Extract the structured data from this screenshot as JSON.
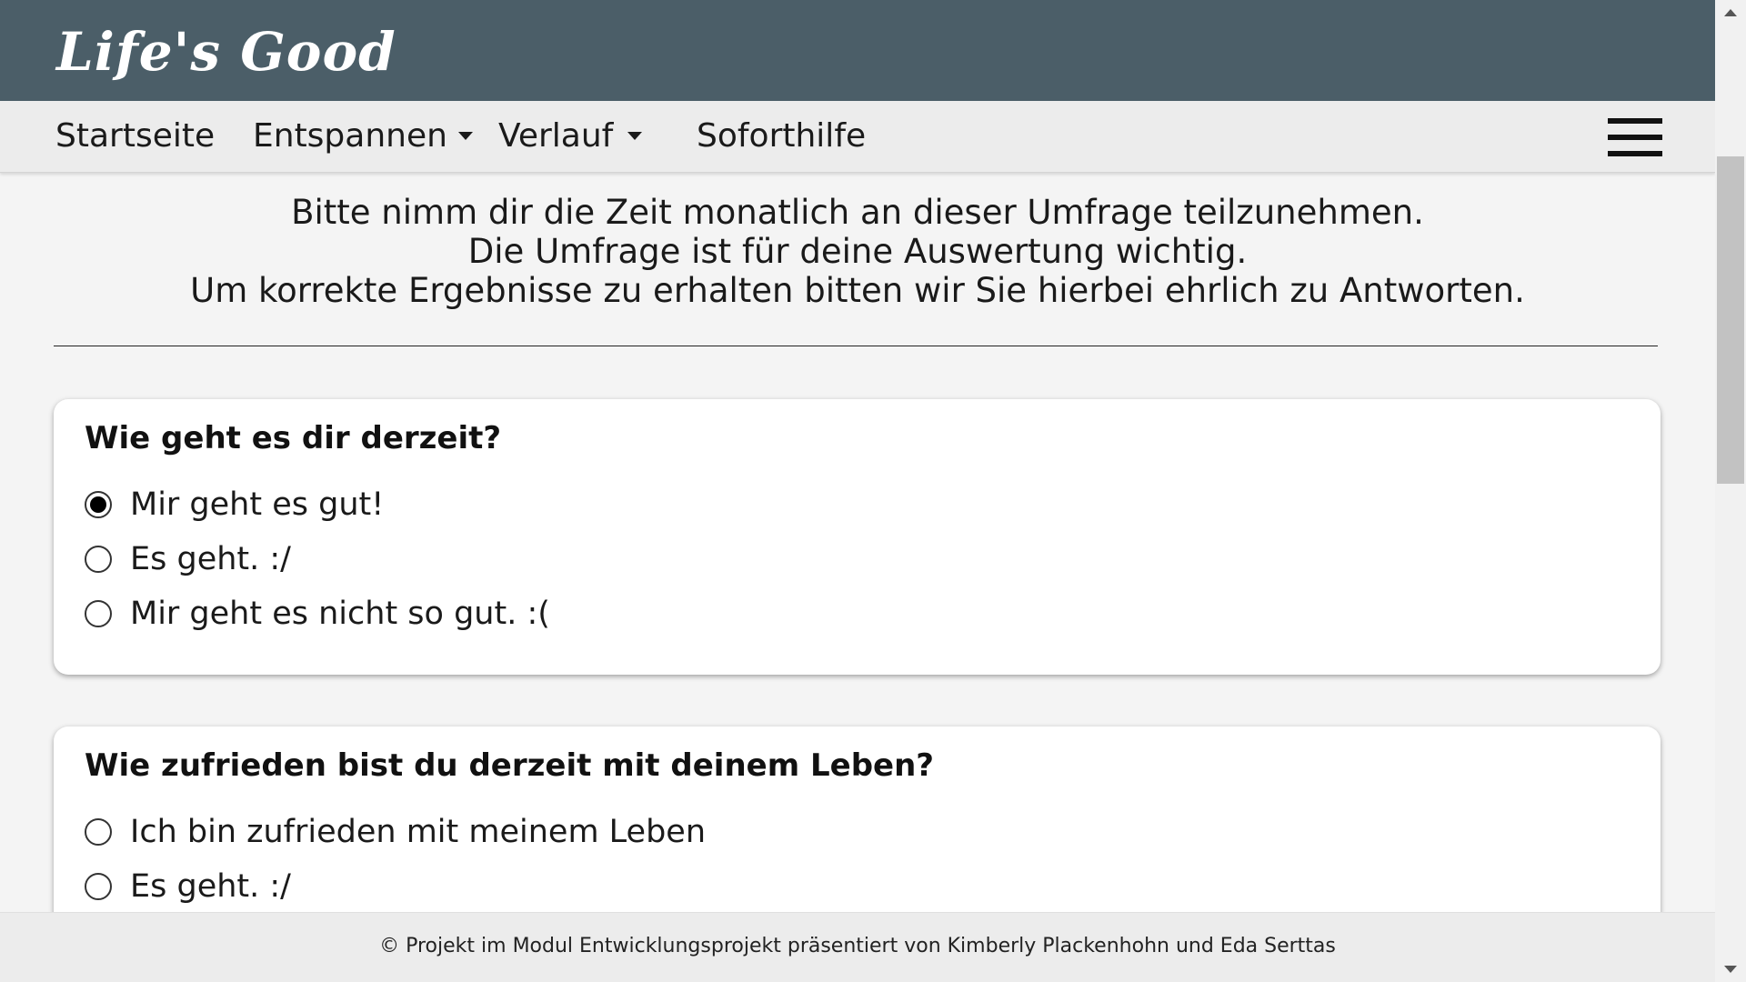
{
  "brand": {
    "logo_text": "Life's Good",
    "header_color": "#4b5e68"
  },
  "nav": {
    "items": [
      {
        "label": "Startseite"
      },
      {
        "label": "Entspannen"
      },
      {
        "label": "Verlauf"
      },
      {
        "label": "Soforthilfe"
      }
    ],
    "menu_icon": "hamburger-menu-icon"
  },
  "intro": {
    "lines": [
      "Bitte nimm dir die Zeit monatlich an dieser Umfrage teilzunehmen.",
      "Die Umfrage ist für deine Auswertung wichtig.",
      "Um korrekte Ergebnisse zu erhalten bitten wir Sie hierbei ehrlich zu Antworten."
    ]
  },
  "questions": [
    {
      "question": "Wie geht es dir derzeit?",
      "options": [
        {
          "label": "Mir geht es gut!",
          "selected": true
        },
        {
          "label": "Es geht. :/",
          "selected": false
        },
        {
          "label": "Mir geht es nicht so gut. :(",
          "selected": false
        }
      ]
    },
    {
      "question": "Wie zufrieden bist du derzeit mit deinem Leben?",
      "options": [
        {
          "label": "Ich bin zufrieden mit meinem Leben",
          "selected": false
        },
        {
          "label": "Es geht. :/",
          "selected": false
        }
      ]
    }
  ],
  "footer": {
    "text": "© Projekt im Modul Entwicklungsprojekt präsentiert von Kimberly Plackenhohn und Eda Serttas"
  }
}
